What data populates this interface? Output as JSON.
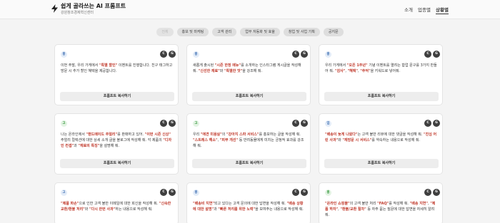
{
  "header": {
    "title": "쉽게 골라쓰는 AI 프롬프트",
    "subtitle": "강원창조경제혁신센터",
    "nav": [
      "소개",
      "업종별",
      "상황별"
    ]
  },
  "filters": [
    "전체",
    "홍보 및 마케팅",
    "고객 관리",
    "업무 자동화 및 효율",
    "창업 및 사업 기획",
    "공지문"
  ],
  "card_ui": {
    "copy_label": "프롬프트 복사하기",
    "avatar_c": "C",
    "avatar_g": "G"
  },
  "cards": [
    {
      "cat": "홍",
      "desc": [
        {
          "t": "이번 주말, 우리 가게에서 "
        },
        {
          "t": "\"특별 할인\"",
          "b": true
        },
        {
          "t": " 이벤트를 진행합니다. 친구 태그하고 방문 시 추가 할인 혜택을 제공합니다."
        }
      ]
    },
    {
      "cat": "홍",
      "desc": [
        {
          "t": "새롭게 출시된 "
        },
        {
          "t": "\"시즌 한정 메뉴\"",
          "b": true
        },
        {
          "t": "를 소개하는 인스타그램 게시글을 작성해 줘. "
        },
        {
          "t": "\"신선한 재료\"",
          "b": true
        },
        {
          "t": "와 "
        },
        {
          "t": "\"특별한 맛\"",
          "b": true
        },
        {
          "t": "을 강조해 줘."
        }
      ]
    },
    {
      "cat": "홍",
      "desc": [
        {
          "t": "우리 가게에서 "
        },
        {
          "t": "\"오픈 1주년\"",
          "b": true
        },
        {
          "t": " 기념 이벤트를 열려는 합업 문구를 3가지 만들어 줘. "
        },
        {
          "t": "\"감사\"",
          "b": true
        },
        {
          "t": ", "
        },
        {
          "t": "\"혜택\"",
          "b": true
        },
        {
          "t": ", "
        },
        {
          "t": "\"추억\"",
          "b": true
        },
        {
          "t": "을 키워드로 넣어줘."
        }
      ]
    },
    {
      "cat": "고",
      "desc": [
        {
          "t": "나는 온라인에서 "
        },
        {
          "t": "\"핸드메이드 주얼리\"",
          "b": true
        },
        {
          "t": "를 판매하고 있어. "
        },
        {
          "t": "\"이번 시즌 신상\"",
          "b": true
        },
        {
          "t": " 주얼리 컬렉션에 대한 상세 소개 글을 블로그에 작성해 줘. 각 제품의 "
        },
        {
          "t": "\"디자인 컨셉\"",
          "b": true
        },
        {
          "t": "과 "
        },
        {
          "t": "\"재료의 특징\"",
          "b": true
        },
        {
          "t": "을 설명해 줘."
        }
      ]
    },
    {
      "cat": "고",
      "desc": [
        {
          "t": "우리 "
        },
        {
          "t": "\"애견 미용실\"",
          "b": true
        },
        {
          "t": "의 "
        },
        {
          "t": "\"강아지 스파 서비스\"",
          "b": true
        },
        {
          "t": "를 홍보하는 글을 작성해 줘. "
        },
        {
          "t": "\"스트레스 해소\"",
          "b": true
        },
        {
          "t": ", "
        },
        {
          "t": "\"피부 개선\"",
          "b": true
        },
        {
          "t": " 등 반려동물에게 미치는 긍정적 효과를 강조해 줘."
        }
      ]
    },
    {
      "cat": "업",
      "desc": [
        {
          "t": ""
        },
        {
          "t": "\"배송이 늦게 나왔다\"",
          "b": true
        },
        {
          "t": "는 고객 불만 리뷰에 대한 댓글을 작성해 줘. "
        },
        {
          "t": "\"진심 어린 사과\"",
          "b": true
        },
        {
          "t": "와 "
        },
        {
          "t": "\"재방문 시 서비스\"",
          "b": true
        },
        {
          "t": "를 약속하는 내용으로 작성해 줘."
        }
      ]
    },
    {
      "cat": "고",
      "desc": [
        {
          "t": ""
        },
        {
          "t": "\"제품 파손\"",
          "b": true
        },
        {
          "t": "으로 인한 고객 불만 이메일에 대한 회신을 작성해 줘. "
        },
        {
          "t": "\"신속한 교환/환불 처리\"",
          "b": true
        },
        {
          "t": "와 "
        },
        {
          "t": "\"다시 한번 사과\"",
          "b": true
        },
        {
          "t": "하는 내용으로 작성해 줘."
        }
      ]
    },
    {
      "cat": "홍",
      "desc": [
        {
          "t": ""
        },
        {
          "t": "\"배송비 지연\"",
          "b": true
        },
        {
          "t": "되고 있다는 고객 문의에 대한 답변을 작성해 줘. "
        },
        {
          "t": "\"배송 상황에 대한 설명\"",
          "b": true
        },
        {
          "t": "과 "
        },
        {
          "t": "\"빠른 처리를 위한 노력\"",
          "b": true
        },
        {
          "t": "을 보여주는 내용으로 작성해 줘."
        }
      ]
    },
    {
      "cat": "홍",
      "desc": [
        {
          "t": ""
        },
        {
          "t": "\"온라인 쇼핑몰\"",
          "b": true
        },
        {
          "t": "의 고객 불만 처리 "
        },
        {
          "t": "\"FAQ\"",
          "b": true
        },
        {
          "t": "를 작성해 줘. "
        },
        {
          "t": "\"배송 지연\"",
          "b": true
        },
        {
          "t": ", "
        },
        {
          "t": "\"제품 하자\"",
          "b": true
        },
        {
          "t": ", "
        },
        {
          "t": "\"환불/교환 절차\"",
          "b": true
        },
        {
          "t": " 등 자주 묻는 질문에 대한 답변을 자세히 알려줘."
        }
      ]
    }
  ]
}
